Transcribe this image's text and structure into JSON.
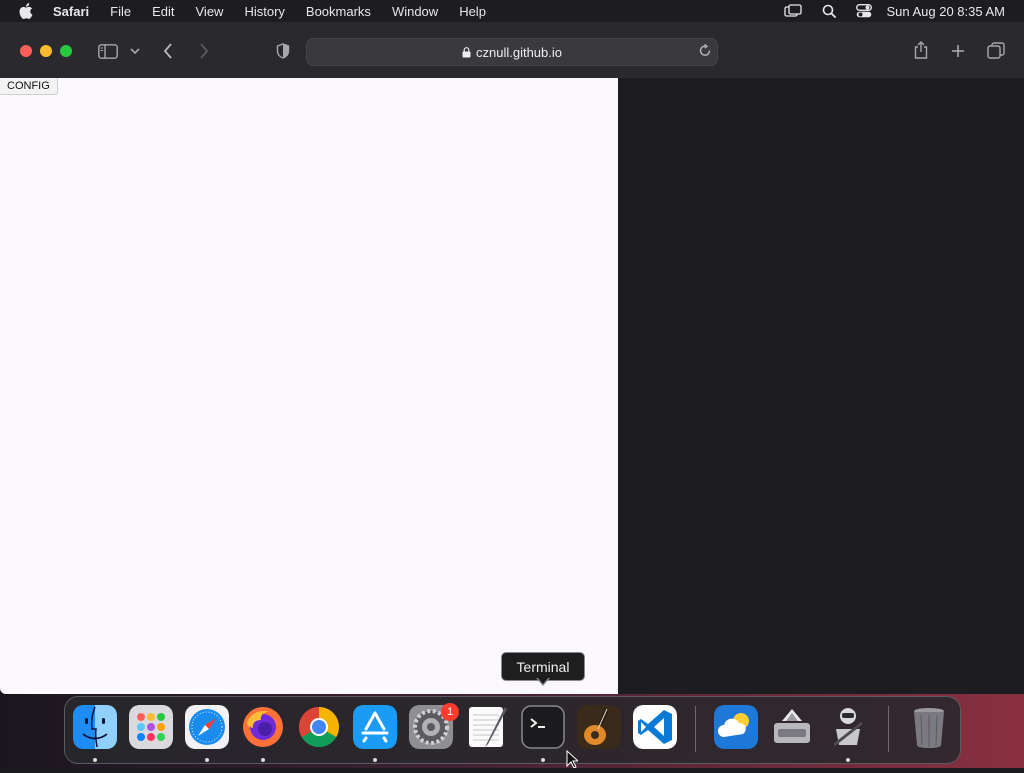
{
  "menubar": {
    "app_name": "Safari",
    "items": [
      "File",
      "Edit",
      "View",
      "History",
      "Bookmarks",
      "Window",
      "Help"
    ],
    "clock": "Sun Aug 20  8:35 AM"
  },
  "toolbar": {
    "url": "cznull.github.io"
  },
  "page": {
    "config_label": "CONFIG"
  },
  "tooltip": {
    "label": "Terminal"
  },
  "dock": {
    "badge_count": "1"
  }
}
